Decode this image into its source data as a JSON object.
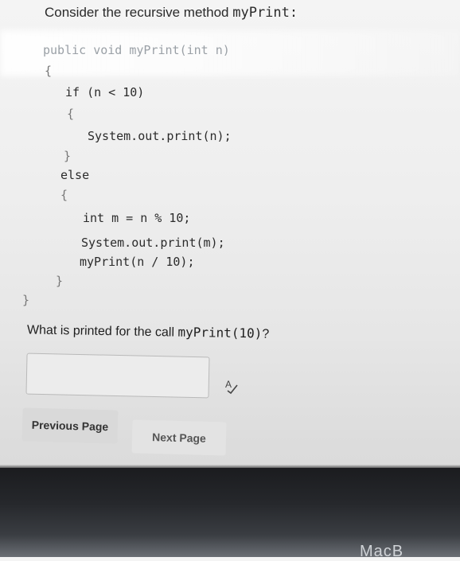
{
  "prompt": {
    "text": "Consider the recursive method ",
    "method": "myPrint",
    "colon": ":"
  },
  "code": {
    "line_signature": "public void myPrint(int n)",
    "line_open": "{",
    "line_if": "if (n < 10)",
    "line_if_open": "{",
    "line_print_n": "System.out.print(n);",
    "line_if_close": "}",
    "line_else": "else",
    "line_else_open": "{",
    "line_mod": "int m = n % 10;",
    "line_print_m": "System.out.print(m);",
    "line_recurse": "myPrint(n / 10);",
    "line_else_close": "}",
    "line_close": "}"
  },
  "question": {
    "text": "What is printed for the call ",
    "call": "myPrint(10)",
    "mark": "?"
  },
  "answer": {
    "value": "",
    "placeholder": ""
  },
  "icons": {
    "spellcheck": "spellcheck-icon"
  },
  "buttons": {
    "previous": "Previous Page",
    "next": "Next Page"
  },
  "laptop": {
    "brand": "MacB"
  }
}
